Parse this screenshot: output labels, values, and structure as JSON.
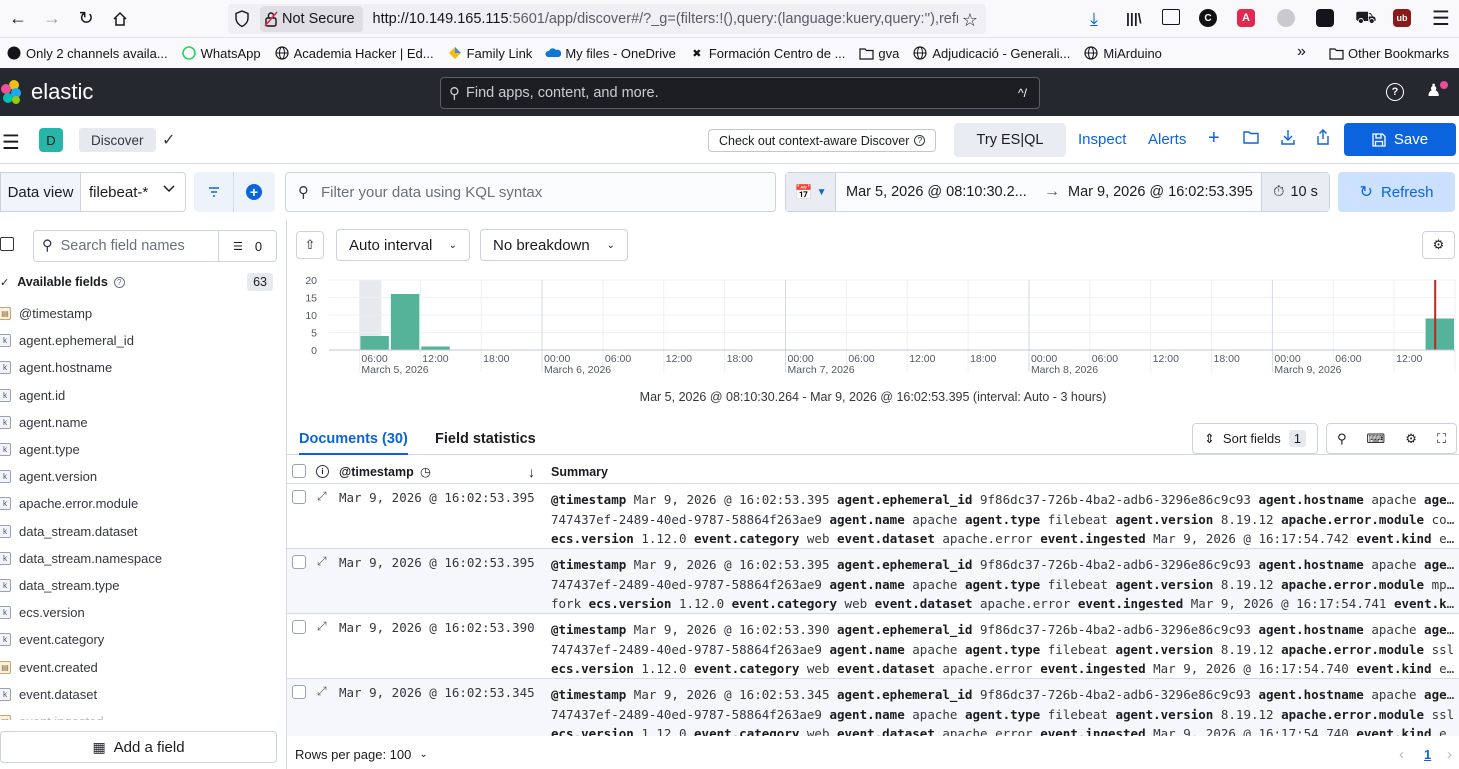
{
  "browser": {
    "security_label": "Not Secure",
    "url_host": "http://10.149.165.115",
    "url_rest": ":5601/app/discover#/?_g=(filters:!(),query:(language:kuery,query:''),refr",
    "bookmarks": [
      {
        "label": "Only 2 channels availa...",
        "icon": "github-icon"
      },
      {
        "label": "WhatsApp",
        "icon": "whatsapp-icon"
      },
      {
        "label": "Academia Hacker | Ed...",
        "icon": "globe-icon"
      },
      {
        "label": "Family Link",
        "icon": "family-link-icon"
      },
      {
        "label": "My files - OneDrive",
        "icon": "onedrive-icon"
      },
      {
        "label": "Formación Centro de ...",
        "icon": "x-icon"
      },
      {
        "label": "gva",
        "icon": "folder-icon"
      },
      {
        "label": "Adjudicació - Generali...",
        "icon": "globe-icon"
      },
      {
        "label": "MiArduino",
        "icon": "globe-icon"
      }
    ],
    "other_bookmarks": "Other Bookmarks"
  },
  "header": {
    "logo": "elastic",
    "search_placeholder": "Find apps, content, and more.",
    "search_shortcut": "^/"
  },
  "appbar": {
    "badge": "D",
    "breadcrumb": "Discover",
    "context_button": "Check out context-aware Discover",
    "try_esql": "Try ES|QL",
    "inspect": "Inspect",
    "alerts": "Alerts",
    "save": "Save"
  },
  "query": {
    "data_view_label": "Data view",
    "data_view_value": "filebeat-*",
    "kql_placeholder": "Filter your data using KQL syntax",
    "start": "Mar 5, 2026 @ 08:10:30.2...",
    "end": "Mar 9, 2026 @ 16:02:53.395",
    "refresh_interval": "10 s",
    "refresh": "Refresh"
  },
  "sidebar": {
    "search_placeholder": "Search field names",
    "filter_count": "0",
    "available_label": "Available fields",
    "available_count": "63",
    "fields": [
      {
        "name": "@timestamp",
        "type": "date"
      },
      {
        "name": "agent.ephemeral_id",
        "type": "k"
      },
      {
        "name": "agent.hostname",
        "type": "k"
      },
      {
        "name": "agent.id",
        "type": "k"
      },
      {
        "name": "agent.name",
        "type": "k"
      },
      {
        "name": "agent.type",
        "type": "k"
      },
      {
        "name": "agent.version",
        "type": "k"
      },
      {
        "name": "apache.error.module",
        "type": "k"
      },
      {
        "name": "data_stream.dataset",
        "type": "k"
      },
      {
        "name": "data_stream.namespace",
        "type": "k"
      },
      {
        "name": "data_stream.type",
        "type": "k"
      },
      {
        "name": "ecs.version",
        "type": "k"
      },
      {
        "name": "event.category",
        "type": "k"
      },
      {
        "name": "event.created",
        "type": "date"
      },
      {
        "name": "event.dataset",
        "type": "k"
      },
      {
        "name": "event.ingested",
        "type": "date"
      }
    ],
    "add_field": "Add a field"
  },
  "histogram": {
    "interval": "Auto interval",
    "breakdown": "No breakdown",
    "caption": "Mar 5, 2026 @ 08:10:30.264 - Mar 9, 2026 @ 16:02:53.395 (interval: Auto - 3 hours)",
    "y_ticks": [
      "20",
      "15",
      "10",
      "5",
      "0"
    ],
    "x_ticks": [
      "06:00",
      "12:00",
      "18:00",
      "00:00",
      "06:00",
      "12:00",
      "18:00",
      "00:00",
      "06:00",
      "12:00",
      "18:00",
      "00:00",
      "06:00",
      "12:00",
      "18:00",
      "00:00",
      "06:00",
      "12:00"
    ],
    "date_ticks": [
      "March 5, 2026",
      "March 6, 2026",
      "March 7, 2026",
      "March 8, 2026",
      "March 9, 2026"
    ]
  },
  "chart_data": {
    "type": "bar",
    "y_range": [
      0,
      20
    ],
    "bars": [
      {
        "time": "Mar 5, 2026 06:00",
        "value": 4
      },
      {
        "time": "Mar 5, 2026 09:00",
        "value": 16
      },
      {
        "time": "Mar 5, 2026 12:00",
        "value": 1
      },
      {
        "time": "Mar 9, 2026 15:00",
        "value": 9
      }
    ],
    "bar_color": "#54b399"
  },
  "docs": {
    "tab_documents": "Documents (30)",
    "tab_stats": "Field statistics",
    "sort_label": "Sort fields",
    "sort_count": "1",
    "col_timestamp": "@timestamp",
    "col_summary": "Summary",
    "rows": [
      {
        "ts": "Mar 9, 2026 @ 16:02:53.395",
        "lines": [
          [
            [
              "@timestamp",
              "Mar 9, 2026 @ 16:02:53.395"
            ],
            [
              "agent.ephemeral_id",
              "9f86dc37-726b-4ba2-adb6-3296e86c9c93"
            ],
            [
              "agent.hostname",
              "apache"
            ],
            [
              "agent.id",
              ""
            ]
          ],
          [
            [
              "",
              "747437ef-2489-40ed-9787-58864f263ae9"
            ],
            [
              "agent.name",
              "apache"
            ],
            [
              "agent.type",
              "filebeat"
            ],
            [
              "agent.version",
              "8.19.12"
            ],
            [
              "apache.error.module",
              "core"
            ]
          ],
          [
            [
              "ecs.version",
              "1.12.0"
            ],
            [
              "event.category",
              "web"
            ],
            [
              "event.dataset",
              "apache.error"
            ],
            [
              "event.ingested",
              "Mar 9, 2026 @ 16:17:54.742"
            ],
            [
              "event.kind",
              "event..."
            ]
          ]
        ]
      },
      {
        "ts": "Mar 9, 2026 @ 16:02:53.395",
        "lines": [
          [
            [
              "@timestamp",
              "Mar 9, 2026 @ 16:02:53.395"
            ],
            [
              "agent.ephemeral_id",
              "9f86dc37-726b-4ba2-adb6-3296e86c9c93"
            ],
            [
              "agent.hostname",
              "apache"
            ],
            [
              "agent.id",
              ""
            ]
          ],
          [
            [
              "",
              "747437ef-2489-40ed-9787-58864f263ae9"
            ],
            [
              "agent.name",
              "apache"
            ],
            [
              "agent.type",
              "filebeat"
            ],
            [
              "agent.version",
              "8.19.12"
            ],
            [
              "apache.error.module",
              "mpm_pre"
            ]
          ],
          [
            [
              "",
              "fork"
            ],
            [
              "ecs.version",
              "1.12.0"
            ],
            [
              "event.category",
              "web"
            ],
            [
              "event.dataset",
              "apache.error"
            ],
            [
              "event.ingested",
              "Mar 9, 2026 @ 16:17:54.741"
            ],
            [
              "event.kind",
              "e..."
            ]
          ]
        ]
      },
      {
        "ts": "Mar 9, 2026 @ 16:02:53.390",
        "lines": [
          [
            [
              "@timestamp",
              "Mar 9, 2026 @ 16:02:53.390"
            ],
            [
              "agent.ephemeral_id",
              "9f86dc37-726b-4ba2-adb6-3296e86c9c93"
            ],
            [
              "agent.hostname",
              "apache"
            ],
            [
              "agent.id",
              ""
            ]
          ],
          [
            [
              "",
              "747437ef-2489-40ed-9787-58864f263ae9"
            ],
            [
              "agent.name",
              "apache"
            ],
            [
              "agent.type",
              "filebeat"
            ],
            [
              "agent.version",
              "8.19.12"
            ],
            [
              "apache.error.module",
              "ssl"
            ]
          ],
          [
            [
              "ecs.version",
              "1.12.0"
            ],
            [
              "event.category",
              "web"
            ],
            [
              "event.dataset",
              "apache.error"
            ],
            [
              "event.ingested",
              "Mar 9, 2026 @ 16:17:54.740"
            ],
            [
              "event.kind",
              "event..."
            ]
          ]
        ]
      },
      {
        "ts": "Mar 9, 2026 @ 16:02:53.345",
        "lines": [
          [
            [
              "@timestamp",
              "Mar 9, 2026 @ 16:02:53.345"
            ],
            [
              "agent.ephemeral_id",
              "9f86dc37-726b-4ba2-adb6-3296e86c9c93"
            ],
            [
              "agent.hostname",
              "apache"
            ],
            [
              "agent.id",
              ""
            ]
          ],
          [
            [
              "",
              "747437ef-2489-40ed-9787-58864f263ae9"
            ],
            [
              "agent.name",
              "apache"
            ],
            [
              "agent.type",
              "filebeat"
            ],
            [
              "agent.version",
              "8.19.12"
            ],
            [
              "apache.error.module",
              "ssl"
            ]
          ],
          [
            [
              "ecs.version",
              "1.12.0"
            ],
            [
              "event.category",
              "web"
            ],
            [
              "event.dataset",
              "apache.error"
            ],
            [
              "event.ingested",
              "Mar 9, 2026 @ 16:17:54.740"
            ],
            [
              "event.kind",
              "event..."
            ]
          ]
        ]
      }
    ],
    "rows_per_page": "Rows per page: 100",
    "page": "1"
  }
}
